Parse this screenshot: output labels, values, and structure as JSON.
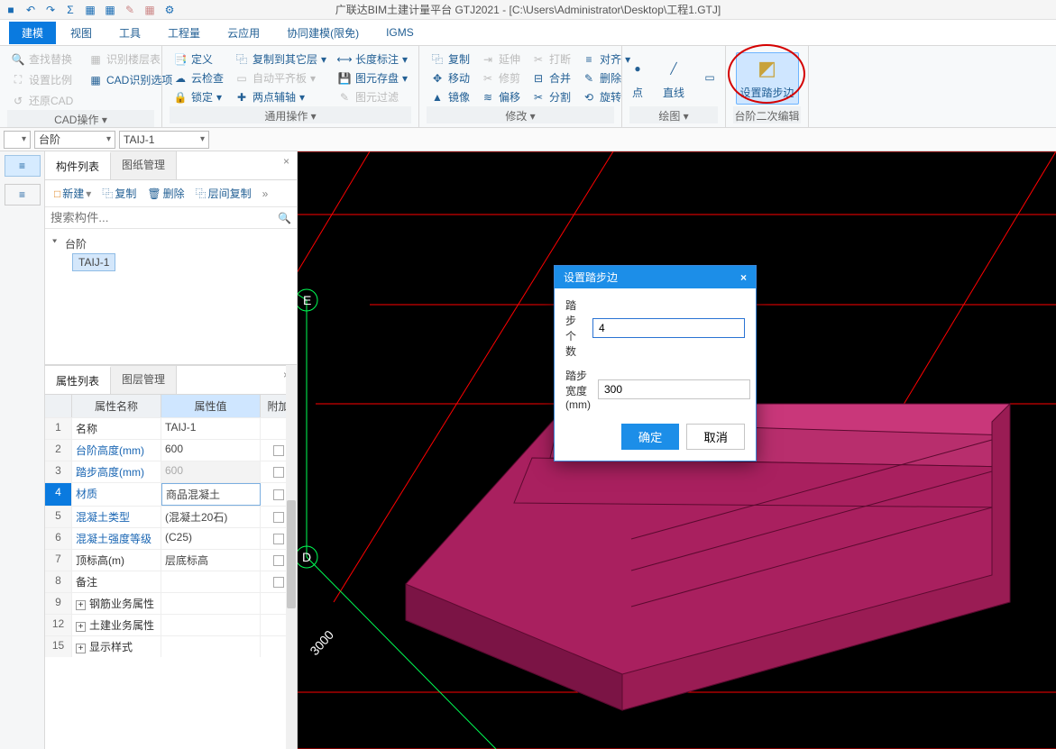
{
  "app": {
    "title_prefix": "广联达BIM土建计量平台 GTJ2021 - ",
    "file_path": "[C:\\Users\\Administrator\\Desktop\\工程1.GTJ]"
  },
  "menu": {
    "tabs": [
      "建模",
      "视图",
      "工具",
      "工程量",
      "云应用",
      "协同建模(限免)",
      "IGMS"
    ],
    "active_index": 0
  },
  "ribbon": {
    "groups": [
      {
        "label": "CAD操作",
        "items": [
          {
            "icon": "🔍",
            "label": "查找替换",
            "disabled": true
          },
          {
            "icon": "▭",
            "label": "识别楼层表",
            "disabled": true
          },
          {
            "icon": "⛶",
            "label": "设置比例",
            "disabled": true
          },
          {
            "icon": "▭",
            "label": "CAD识别选项",
            "disabled": false
          },
          {
            "icon": "↺",
            "label": "还原CAD",
            "disabled": true
          }
        ]
      },
      {
        "label": "通用操作",
        "cols": [
          [
            {
              "icon": "📑",
              "label": "定义"
            },
            {
              "icon": "☁",
              "label": "云检查"
            },
            {
              "icon": "🔒",
              "label": "锁定",
              "dd": true
            }
          ],
          [
            {
              "icon": "⿻",
              "label": "复制到其它层",
              "dd": true
            },
            {
              "icon": "▭",
              "label": "自动平齐板",
              "dd": true,
              "disabled": true
            },
            {
              "icon": "✚",
              "label": "两点辅轴",
              "dd": true
            }
          ],
          [
            {
              "icon": "⟷",
              "label": "长度标注",
              "dd": true
            },
            {
              "icon": "💾",
              "label": "图元存盘",
              "dd": true
            },
            {
              "icon": "✎",
              "label": "图元过滤",
              "disabled": true
            }
          ]
        ]
      },
      {
        "label": "修改",
        "cols": [
          [
            {
              "icon": "⿻",
              "label": "复制"
            },
            {
              "icon": "✥",
              "label": "移动"
            },
            {
              "icon": "▲",
              "label": "镜像"
            }
          ],
          [
            {
              "icon": "⇥",
              "label": "延伸",
              "disabled": true
            },
            {
              "icon": "✂",
              "label": "修剪",
              "disabled": true
            },
            {
              "icon": "≋",
              "label": "偏移"
            }
          ],
          [
            {
              "icon": "✂",
              "label": "打断",
              "disabled": true
            },
            {
              "icon": "⊟",
              "label": "合并"
            },
            {
              "icon": "✂",
              "label": "分割"
            }
          ],
          [
            {
              "icon": "≡",
              "label": "对齐",
              "dd": true
            },
            {
              "icon": "✎",
              "label": "删除"
            },
            {
              "icon": "⟲",
              "label": "旋转"
            }
          ]
        ]
      },
      {
        "label": "绘图",
        "big": [
          {
            "icon": "•",
            "label": "点"
          },
          {
            "icon": "╱",
            "label": "直线"
          },
          {
            "icon": "▭",
            "label": "□"
          }
        ]
      },
      {
        "label": "台阶二次编辑",
        "big": [
          {
            "icon": "◩",
            "label": "设置踏步边",
            "highlight": true
          }
        ],
        "ellipse": true
      }
    ]
  },
  "selectors": {
    "dd1": "",
    "dd2": "台阶",
    "dd3": "TAIJ-1"
  },
  "left_panel": {
    "tabs": [
      "构件列表",
      "图纸管理"
    ],
    "active": 0,
    "toolbar": [
      "新建",
      "复制",
      "删除",
      "层间复制"
    ],
    "search_placeholder": "搜索构件...",
    "tree": {
      "root": "台阶",
      "child": "TAIJ-1"
    }
  },
  "prop_panel": {
    "tabs": [
      "属性列表",
      "图层管理"
    ],
    "active": 0,
    "cols": {
      "name": "属性名称",
      "value": "属性值",
      "extra": "附加"
    },
    "rows": [
      {
        "n": "1",
        "name": "名称",
        "value": "TAIJ-1",
        "chk": false,
        "plain": true
      },
      {
        "n": "2",
        "name": "台阶高度(mm)",
        "value": "600",
        "chk": true
      },
      {
        "n": "3",
        "name": "踏步高度(mm)",
        "value": "600",
        "chk": true,
        "disabled": true
      },
      {
        "n": "4",
        "name": "材质",
        "value": "商品混凝土",
        "chk": true,
        "selected": true,
        "edit": true
      },
      {
        "n": "5",
        "name": "混凝土类型",
        "value": "(混凝土20石)",
        "chk": true
      },
      {
        "n": "6",
        "name": "混凝土强度等级",
        "value": "(C25)",
        "chk": true
      },
      {
        "n": "7",
        "name": "顶标高(m)",
        "value": "层底标高",
        "chk": true,
        "plain": true
      },
      {
        "n": "8",
        "name": "备注",
        "value": "",
        "chk": true,
        "plain": true
      },
      {
        "n": "9",
        "name": "钢筋业务属性",
        "value": "",
        "expand": true,
        "plain": true
      },
      {
        "n": "12",
        "name": "土建业务属性",
        "value": "",
        "expand": true,
        "plain": true
      },
      {
        "n": "15",
        "name": "显示样式",
        "value": "",
        "expand": true,
        "plain": true
      }
    ]
  },
  "viewport": {
    "anchors": {
      "E": "E",
      "D": "D"
    },
    "dim_label": "3000"
  },
  "dialog": {
    "title": "设置踏步边",
    "field1_label": "踏步个数",
    "field1_value": "4",
    "field2_label": "踏步宽度(mm)",
    "field2_value": "300",
    "ok": "确定",
    "cancel": "取消"
  }
}
